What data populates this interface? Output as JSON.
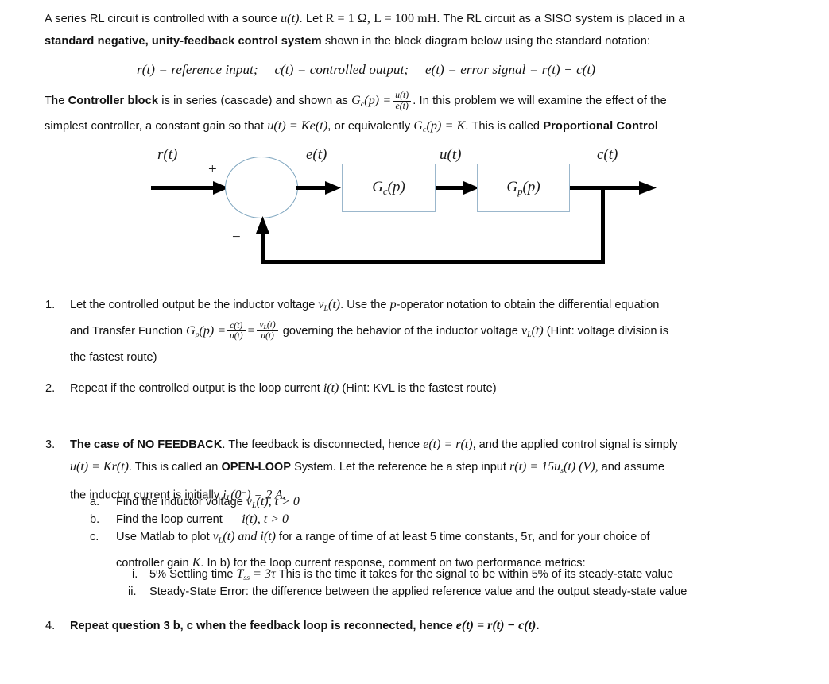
{
  "document": {
    "background_color": "#ffffff",
    "text_color": "#111111",
    "accent_color": "#9bb7cc"
  },
  "intro": {
    "line1_a": "A series RL circuit is controlled with a source ",
    "line1_u": "u(t)",
    "line1_b": ".  Let ",
    "line1_R": "R = 1 Ω,",
    "line1_L": "L = 100 mH",
    "line1_c": ".   The RL circuit as a SISO system is placed in a",
    "line2_bold": "standard negative, unity-feedback control system",
    "line2_rest": " shown in the block diagram below using the standard notation:",
    "definitions_r": "r(t) = reference input;",
    "definitions_c": "c(t) = controlled output;",
    "definitions_e": "e(t) = error signal = r(t) − c(t)"
  },
  "controller": {
    "line1_a": "The ",
    "line1_bold": "Controller block",
    "line1_b": " is in series (cascade) and shown as  ",
    "line1_gc": "G",
    "line1_gc_sub": "c",
    "line1_gc_rest": "(p) =",
    "frac_num": "u(t)",
    "frac_den": "e(t)",
    "line1_c": ".    In this problem we will examine the effect of the",
    "line2_a": "simplest controller, a constant gain so that ",
    "line2_eq1": "u(t) = Ke(t)",
    "line2_b": ", or equivalently   ",
    "line2_eq2": "G",
    "line2_eq2_sub": "c",
    "line2_eq2_rest": "(p) = K",
    "line2_c": ".  This is called ",
    "line2_bold": "Proportional Control"
  },
  "diagram": {
    "label_r": "r(t)",
    "label_e": "e(t)",
    "label_u": "u(t)",
    "label_c": "c(t)",
    "sign_plus": "+",
    "sign_minus": "−",
    "block1_G": "G",
    "block1_sub": "c",
    "block1_arg": "(p)",
    "block2_G": "G",
    "block2_sub": "p",
    "block2_arg": "(p)"
  },
  "questions": [
    {
      "number": "1.",
      "lines": [
        "Let the controlled output be the inductor voltage  v_L(t).  Use the p-operator notation to obtain the differential equation",
        "and Transfer Function  G_p(p) = c(t)/u(t) = v_L(t)/u(t)  governing the behavior of the inductor voltage v_L(t)  (Hint: voltage division is",
        "the fastest route)"
      ],
      "l1_a": "Let the controlled output be the inductor voltage ",
      "l1_v": "v",
      "l1_v_sub": "L",
      "l1_v_rest": "(t)",
      "l1_b": ".  Use the ",
      "l1_p": "p",
      "l1_c": "-operator notation to obtain the differential equation",
      "l2_a": "and Transfer Function  ",
      "l2_G": "G",
      "l2_G_sub": "p",
      "l2_G_rest": "(p) =",
      "l2_f1_num": "c(t)",
      "l2_f1_den": "u(t)",
      "l2_eq": "=",
      "l2_f2_num": "v",
      "l2_f2_num_sub": "L",
      "l2_f2_num_rest": "(t)",
      "l2_f2_den": "u(t)",
      "l2_b": " governing the behavior of the inductor voltage ",
      "l2_v": "v",
      "l2_v_sub": "L",
      "l2_v_rest": "(t)",
      "l2_c": "  (Hint: voltage division is",
      "l3": "the fastest route)"
    },
    {
      "number": "2.",
      "l1_a": "Repeat if the controlled output is the loop current ",
      "l1_i": "i(t)",
      "l1_b": "  (Hint: KVL is the fastest route)"
    },
    {
      "number": "3.",
      "l1_bold": "The case of NO FEEDBACK",
      "l1_a": ".  The feedback is disconnected, hence ",
      "l1_e": "e(t) = r(t)",
      "l1_b": ", and the applied control signal is simply",
      "l2_u": "u(t) = Kr(t)",
      "l2_a": ".  This is called an ",
      "l2_bold": "OPEN-LOOP",
      "l2_b": " System.  Let the reference be a step input   ",
      "l2_r": "r(t) = 15u",
      "l2_r_sub": "s",
      "l2_r_rest": "(t) (V),",
      "l2_c": "  and assume",
      "l3_a": "the inductor current is initially   ",
      "l3_i": "i",
      "l3_i_sub": "L",
      "l3_i_rest": "(0",
      "l3_i_sup": "−",
      "l3_i_end": ") = 2 A."
    },
    {
      "number": "4.",
      "l1_bold_a": "Repeat question 3 b, c when the feedback loop is reconnected, hence ",
      "l1_bold_eq": "e(t) = r(t) − c(t)",
      "l1_bold_b": "."
    }
  ],
  "subitems_3": [
    {
      "letter": "a.",
      "text_a": "Find the inductor voltage  ",
      "text_v": "v",
      "text_v_sub": "L",
      "text_v_rest": "(t), t > 0"
    },
    {
      "letter": "b.",
      "text_a": "Find the loop current",
      "text_v": "i(t),  t > 0"
    },
    {
      "letter": "c.",
      "l1_a": "Use Matlab to plot ",
      "l1_v": "v",
      "l1_v_sub": "L",
      "l1_v_rest": "(t)",
      "l1_and": " and ",
      "l1_i": "i(t)",
      "l1_b": "  for a range of time of at least 5 time constants, 5",
      "l1_tau": "τ",
      "l1_c": ", and for your choice of",
      "l2_a": "controller gain ",
      "l2_K": "K",
      "l2_b": ".  In b) for the loop current response, comment on two performance metrics:"
    }
  ],
  "romans_3c": [
    {
      "numeral": "i.",
      "text_a": "5% Settling time ",
      "text_T": "T",
      "text_T_sub": "ss",
      "text_T_rest": " = 3",
      "text_tau": "τ",
      "text_b": "  This is the time it takes for the signal to be within 5% of its steady-state value"
    },
    {
      "numeral": "ii.",
      "text_a": "Steady-State Error: the difference between the applied reference value and the output steady-state value"
    }
  ]
}
